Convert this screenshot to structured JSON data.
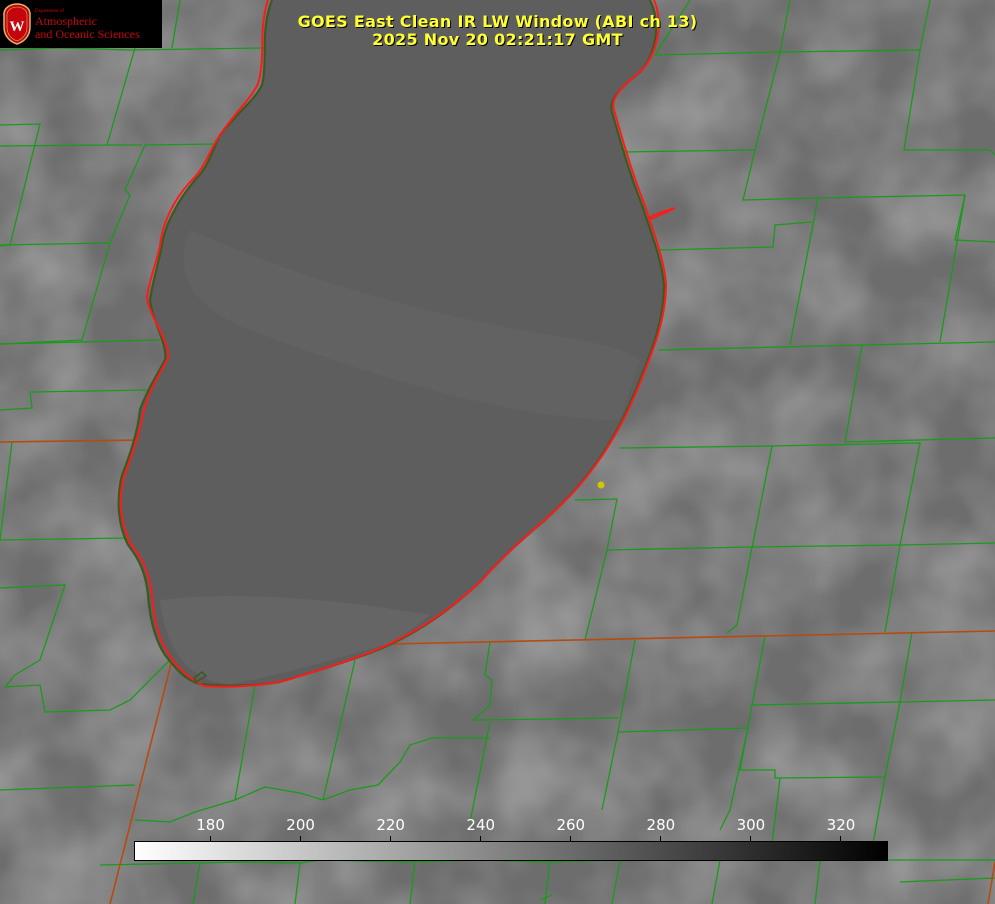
{
  "title": {
    "line1": "GOES East Clean IR LW Window (ABI ch 13)",
    "line2": "2025 Nov 20 02:21:17 GMT"
  },
  "logo": {
    "letter": "W",
    "department": "Department of",
    "line1": "Atmospheric",
    "line2": "and Oceanic Sciences"
  },
  "colorbar": {
    "min": 163,
    "max": 330,
    "ticks": [
      "180",
      "200",
      "220",
      "240",
      "260",
      "280",
      "300",
      "320"
    ],
    "tick_values": [
      180,
      200,
      220,
      240,
      260,
      280,
      300,
      320
    ],
    "colors": [
      "#ffffff",
      "#000000"
    ]
  },
  "colors": {
    "title": "#ffff33",
    "county_lines": "#1a9a1a",
    "state_lines": "#b84a10",
    "coastline": "#ff2020",
    "marker": "#d4c400"
  }
}
